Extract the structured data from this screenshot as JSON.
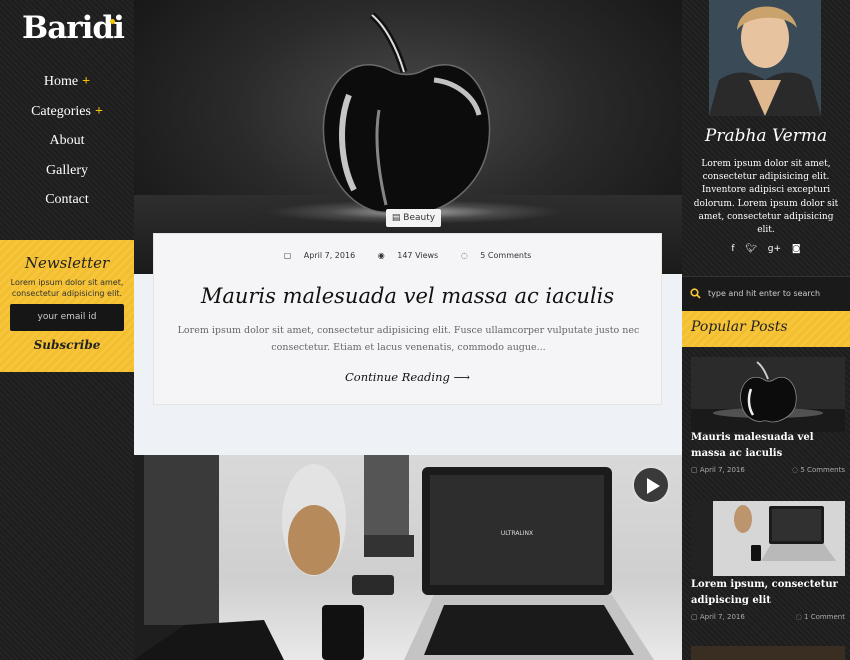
{
  "brand": {
    "logo": "Baridi"
  },
  "nav": [
    {
      "label": "Home",
      "has_sub": "+"
    },
    {
      "label": "Categories",
      "has_sub": "+"
    },
    {
      "label": "About"
    },
    {
      "label": "Gallery"
    },
    {
      "label": "Contact"
    }
  ],
  "newsletter": {
    "title": "Newsletter",
    "text": "Lorem ipsum dolor sit amet, consectetur adipisicing elit.",
    "placeholder": "your email id",
    "subscribe": "Subscribe"
  },
  "featured": {
    "category": "Beauty",
    "date": "April 7, 2016",
    "views": "147 Views",
    "comments": "5 Comments",
    "title": "Mauris malesuada vel massa ac iaculis",
    "excerpt": "Lorem ipsum dolor sit amet, consectetur adipisicing elit. Fusce ullamcorper vulputate justo nec consectetur. Etiam et lacus venenatis, commodo augue...",
    "continue": "Continue Reading"
  },
  "author": {
    "name": "Prabha Verma",
    "bio": "Lorem ipsum dolor sit amet, consectetur adipisicing elit. Inventore adipisci excepturi dolorum. Lorem ipsum dolor sit amet, consectetur adipisicing elit.",
    "socials": [
      "facebook-icon",
      "twitter-icon",
      "google-plus-icon",
      "instagram-icon"
    ]
  },
  "search": {
    "placeholder": "type and hit enter to search"
  },
  "popular": {
    "heading": "Popular Posts",
    "posts": [
      {
        "title": "Mauris malesuada vel massa ac iaculis",
        "date": "April 7, 2016",
        "comments": "5 Comments"
      },
      {
        "title": "Lorem ipsum, consectetur adipiscing elit",
        "date": "April 7, 2016",
        "comments": "1 Comment"
      }
    ]
  },
  "colors": {
    "accent": "#f6c53b",
    "dark": "#1f1f1f",
    "card": "#f5f5f7"
  }
}
